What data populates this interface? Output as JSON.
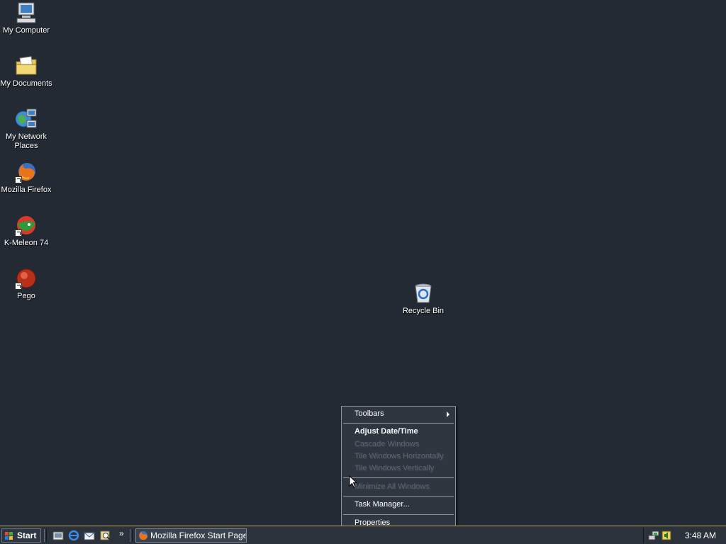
{
  "desktop": {
    "icons": [
      {
        "label": "My Computer",
        "icon": "computer-icon"
      },
      {
        "label": "My Documents",
        "icon": "folder-icon"
      },
      {
        "label": "My Network Places",
        "icon": "network-icon"
      },
      {
        "label": "Mozilla Firefox",
        "icon": "firefox-icon"
      },
      {
        "label": "K-Meleon 74",
        "icon": "kmeleon-icon"
      },
      {
        "label": "Pego",
        "icon": "pego-icon"
      },
      {
        "label": "Recycle Bin",
        "icon": "recycle-bin-icon"
      }
    ]
  },
  "context_menu": {
    "items": [
      {
        "label": "Toolbars",
        "has_submenu": true
      },
      {
        "label": "Adjust Date/Time",
        "bold": true
      },
      {
        "label": "Cascade Windows",
        "disabled": true
      },
      {
        "label": "Tile Windows Horizontally",
        "disabled": true
      },
      {
        "label": "Tile Windows Vertically",
        "disabled": true
      },
      {
        "label": "Minimize All Windows",
        "disabled": true
      },
      {
        "label": "Task Manager..."
      },
      {
        "label": "Properties"
      }
    ]
  },
  "taskbar": {
    "start_label": "Start",
    "quick_launch": [
      "show-desktop-icon",
      "internet-explorer-icon",
      "outlook-express-icon",
      "search-icon"
    ],
    "overflow": "»",
    "task_button": "Mozilla Firefox Start Page...",
    "tray_icons": [
      "network-tray-icon",
      "volume-tray-icon"
    ],
    "clock": "3:48 AM"
  },
  "colors": {
    "desktop_bg": "#232a33",
    "menu_bg": "#2f3640",
    "taskbar_bg": "#2b323b"
  }
}
